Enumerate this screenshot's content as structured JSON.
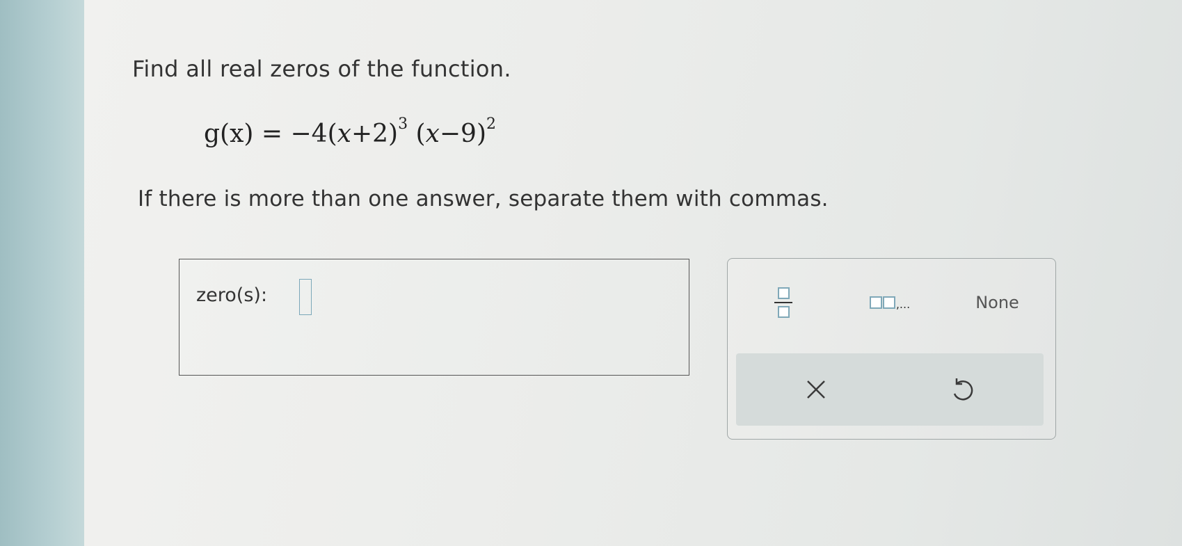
{
  "question": {
    "prompt": "Find all real zeros of the function.",
    "equation": {
      "lhs": "g",
      "arg": "(x)",
      "eq": " = −4(",
      "x1": "x",
      "plus_two": "+2)",
      "exp1": "3",
      "open2": " (",
      "x2": "x",
      "minus_nine": "−9)",
      "exp2": "2"
    },
    "instruction": "If there is more than one answer, separate them with commas."
  },
  "answer": {
    "label": "zero(s):",
    "value": ""
  },
  "keypad": {
    "fraction_icon": "fraction-icon",
    "list_icon": "list-icon",
    "list_dots": ",...",
    "none_label": "None",
    "clear_icon": "close-icon",
    "undo_icon": "undo-icon"
  },
  "colors": {
    "input_border": "#7aa7b8",
    "action_bar": "#d5dbda",
    "text": "#333333"
  }
}
